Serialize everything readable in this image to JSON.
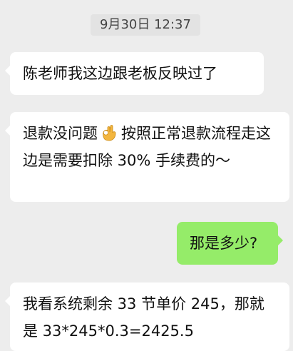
{
  "timestamp": "9月30日 12:37",
  "messages": [
    {
      "side": "left",
      "text": "陈老师我这边跟老板反映过了"
    },
    {
      "side": "left",
      "text_before": "退款没问题",
      "emoji": "ok-hand-icon",
      "text_after": "按照正常退款流程走这边是需要扣除 30% 手续费的～"
    },
    {
      "side": "right",
      "text": "那是多少?"
    },
    {
      "side": "left",
      "text": "我看系统剩余 33 节单价 245，那就是 33*245*0.3=2425.5"
    }
  ],
  "colors": {
    "background": "#ededed",
    "incoming_bubble": "#ffffff",
    "outgoing_bubble": "#95ec69"
  }
}
